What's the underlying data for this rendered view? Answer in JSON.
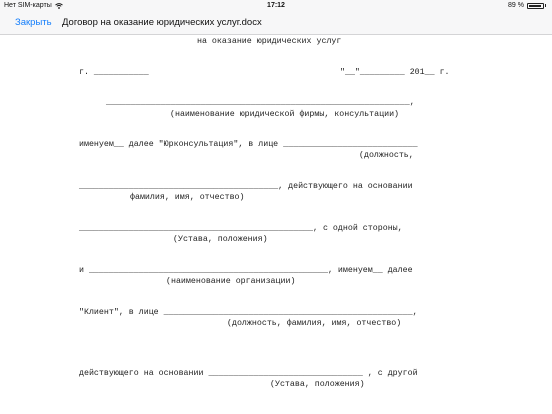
{
  "status_bar": {
    "carrier": "Нет SIM-карты",
    "time": "17:12",
    "battery_text": "89 %",
    "battery_level": 0.89
  },
  "nav": {
    "close_label": "Закрыть",
    "title": "Договор на оказание юридических услуг.docx"
  },
  "document": {
    "lines": [
      "на оказание юридических услуг",
      "г. ___________",
      "\"__\"_________ 201__ г.",
      "_____________________________________________________________,",
      "(наименование юридической фирмы, консультации)",
      "именуем__ далее \"Юрконсультация\", в лице ___________________________",
      "(должность,",
      "________________________________________, действующего на основании",
      "фамилия, имя, отчество)",
      "_______________________________________________, с одной стороны,",
      "(Устава, положения)",
      "и ________________________________________________, именуем__ далее",
      "(наименование организации)",
      "\"Клиент\", в лице __________________________________________________,",
      "(должность, фамилия, имя, отчество)",
      "действующего на основании _______________________________ , с другой",
      "(Устава, положения)"
    ]
  }
}
